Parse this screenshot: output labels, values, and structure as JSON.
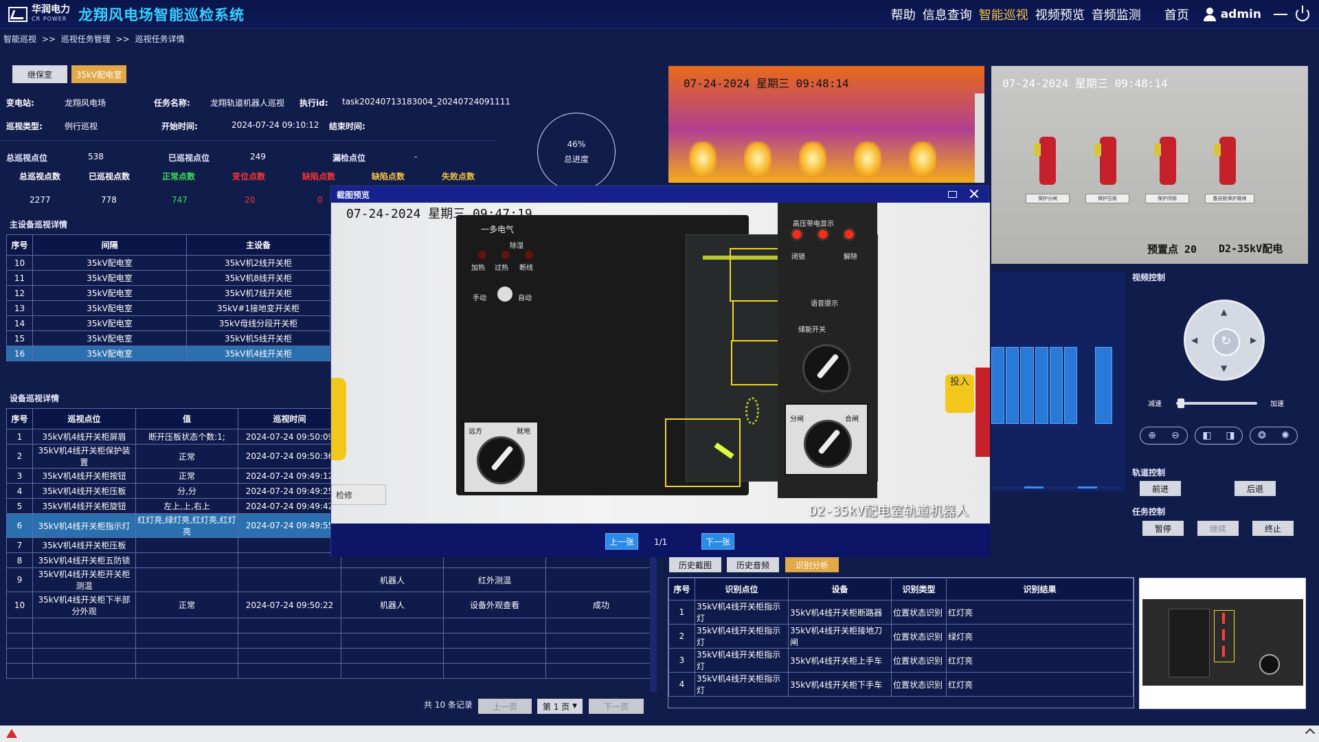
{
  "header": {
    "logo_cn": "华润电力",
    "logo_en": "CR POWER",
    "title": "龙翔风电场智能巡检系统",
    "nav": [
      "帮助",
      "信息查询",
      "智能巡视",
      "视频预览",
      "音频监测",
      "首页"
    ],
    "active_nav": "智能巡视",
    "user": "admin"
  },
  "breadcrumb": [
    "智能巡视",
    ">>",
    "巡视任务管理",
    ">>",
    "巡视任务详情"
  ],
  "tabs": [
    "继保室",
    "35kV配电室"
  ],
  "info": {
    "substation_label": "变电站:",
    "substation": "龙翔风电场",
    "task_label": "任务名称:",
    "task": "龙翔轨道机器人巡视",
    "exec_label": "执行id:",
    "exec": "task20240713183004_20240724091111",
    "type_label": "巡视类型:",
    "type": "例行巡视",
    "start_label": "开始时间:",
    "start": "2024-07-24 09:10:12",
    "end_label": "结束时间:"
  },
  "stats": {
    "total_points_label": "总巡视点位",
    "total_points": "538",
    "done_points_label": "已巡视点位",
    "done_points": "249",
    "missed_label": "漏检点位",
    "missed": "-",
    "cols": [
      "总巡视点数",
      "已巡视点数",
      "正常点数",
      "变位点数",
      "缺陷点数",
      "缺陷点数",
      "失败点数"
    ],
    "values": [
      "2277",
      "778",
      "747",
      "20",
      "0"
    ]
  },
  "progress": {
    "pct": "46%",
    "label": "总进度"
  },
  "main_equipment": {
    "title": "主设备巡视详情",
    "headers": [
      "序号",
      "间隔",
      "主设备"
    ],
    "rows": [
      [
        "10",
        "35kV配电室",
        "35kV机2线开关柜"
      ],
      [
        "11",
        "35kV配电室",
        "35kV机8线开关柜"
      ],
      [
        "12",
        "35kV配电室",
        "35kV机7线开关柜"
      ],
      [
        "13",
        "35kV配电室",
        "35kV#1接地变开关柜"
      ],
      [
        "14",
        "35kV配电室",
        "35kV母线分段开关柜"
      ],
      [
        "15",
        "35kV配电室",
        "35kV机5线开关柜"
      ],
      [
        "16",
        "35kV配电室",
        "35kV机4线开关柜"
      ]
    ],
    "selected": 6
  },
  "device_detail": {
    "title": "设备巡视详情",
    "headers": [
      "序号",
      "巡视点位",
      "值",
      "巡视时间",
      "",
      "",
      ""
    ],
    "rows": [
      [
        "1",
        "35kV机4线开关柜屏眉",
        "断开压板状态个数:1;",
        "2024-07-24 09:50:09",
        "",
        "",
        ""
      ],
      [
        "2",
        "35kV机4线开关柜保护装置",
        "正常",
        "2024-07-24 09:50:36",
        "",
        "",
        ""
      ],
      [
        "3",
        "35kV机4线开关柜按钮",
        "正常",
        "2024-07-24 09:49:12",
        "",
        "",
        ""
      ],
      [
        "4",
        "35kV机4线开关柜压板",
        "分,分",
        "2024-07-24 09:49:25",
        "",
        "",
        ""
      ],
      [
        "5",
        "35kV机4线开关柜旋钮",
        "左上,上,右上",
        "2024-07-24 09:49:42",
        "",
        "",
        ""
      ],
      [
        "6",
        "35kV机4线开关柜指示灯",
        "红灯亮,绿灯亮,红灯亮,红灯亮",
        "2024-07-24 09:49:55",
        "",
        "",
        ""
      ],
      [
        "7",
        "35kV机4线开关柜压板",
        "",
        "",
        "",
        "",
        ""
      ],
      [
        "8",
        "35kV机4线开关柜五防锁",
        "",
        "",
        "",
        "",
        ""
      ],
      [
        "9",
        "35kV机4线开关柜开关柜测温",
        "",
        "",
        "机器人",
        "红外测温",
        ""
      ],
      [
        "10",
        "35kV机4线开关柜下半部分外观",
        "正常",
        "2024-07-24 09:50:22",
        "机器人",
        "设备外观查看",
        "成功"
      ]
    ],
    "selected": 5
  },
  "pager": {
    "total": "共 10 条记录",
    "prev": "上一页",
    "page": "第 1 页",
    "next": "下一页"
  },
  "thermal": {
    "ts": "07-24-2024 星期三 09:48:14"
  },
  "camera": {
    "ts": "07-24-2024 星期三 09:48:14",
    "preset": "预置点 20",
    "location": "D2-35kV配电"
  },
  "camera_plaques": [
    "保护分闸",
    "保护压板",
    "保护闭锁",
    "备自投保护跳闸"
  ],
  "controls": {
    "video_title": "视频控制",
    "slow": "减速",
    "fast": "加速",
    "track_title": "轨道控制",
    "forward": "前进",
    "back": "后退",
    "task_title": "任务控制",
    "pause": "暂停",
    "resume": "继续",
    "stop": "终止"
  },
  "history_tabs": [
    "历史截图",
    "历史音频",
    "识别分析"
  ],
  "recog": {
    "headers": [
      "序号",
      "识别点位",
      "设备",
      "识别类型",
      "识别结果"
    ],
    "rows": [
      [
        "1",
        "35kV机4线开关柜指示灯",
        "35kV机4线开关柜断路器",
        "位置状态识别",
        "红灯亮"
      ],
      [
        "2",
        "35kV机4线开关柜指示灯",
        "35kV机4线开关柜接地刀闸",
        "位置状态识别",
        "绿灯亮"
      ],
      [
        "3",
        "35kV机4线开关柜指示灯",
        "35kV机4线开关柜上手车",
        "位置状态识别",
        "红灯亮"
      ],
      [
        "4",
        "35kV机4线开关柜指示灯",
        "35kV机4线开关柜下手车",
        "位置状态识别",
        "红灯亮"
      ]
    ]
  },
  "modal": {
    "title": "截图预览",
    "ts": "07-24-2024 星期三 09:47:19",
    "caption": "D2-35kV配电室轨道机器人",
    "prev": "上一张",
    "next": "下一张",
    "page": "1/1",
    "brand": "一多电气",
    "labels": [
      "加热",
      "过热",
      "除湿",
      "断线",
      "手动",
      "自动",
      "远方",
      "就地",
      "分闸",
      "合闸",
      "高压带电显示",
      "闭锁",
      "解除",
      "语音提示",
      "储能开关",
      "储能",
      "投入",
      "检修"
    ]
  },
  "colors": {
    "accent": "#3ad0ff",
    "active_nav": "#f5c542",
    "normal": "#3de05a",
    "shift": "#ff3434",
    "defect": "#ff3434",
    "missing": "#f5c542",
    "fail": "#f5c542"
  }
}
